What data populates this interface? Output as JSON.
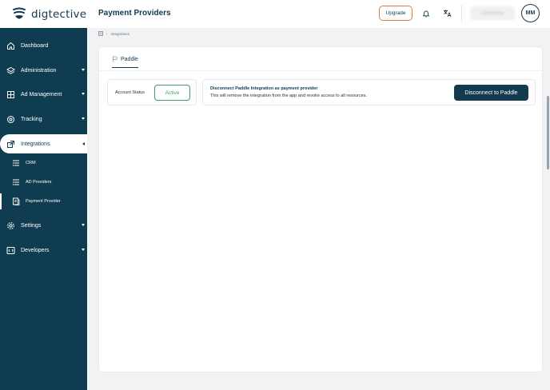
{
  "app": {
    "logo_text": "digtective",
    "logo_icon": "digtective-logo-icon"
  },
  "header": {
    "title": "Payment Providers",
    "upgrade_label": "Upgrade",
    "bell_icon": "bell-icon",
    "language_icon": "translate-icon",
    "user_name": "Username",
    "avatar_initials": "MM"
  },
  "sidebar": {
    "items": [
      {
        "label": "Dashboard",
        "icon": "home-icon"
      },
      {
        "label": "Administration",
        "icon": "layers-icon"
      },
      {
        "label": "Ad Management",
        "icon": "grid-icon"
      },
      {
        "label": "Tracking",
        "icon": "target-icon"
      },
      {
        "label": "Integrations",
        "icon": "integrations-icon"
      },
      {
        "label": "Settings",
        "icon": "gear-icon"
      },
      {
        "label": "Developers",
        "icon": "code-icon"
      }
    ],
    "sub_items": [
      {
        "label": "CRM",
        "icon": "list-icon"
      },
      {
        "label": "AD Providers",
        "icon": "list-icon"
      },
      {
        "label": "Payment Provider",
        "icon": "document-icon"
      }
    ]
  },
  "breadcrumb": {
    "home_icon": "home-icon",
    "current": "Integrations"
  },
  "tabs": [
    {
      "label": "Paddle",
      "icon": "paddle-icon"
    }
  ],
  "account_status": {
    "label": "Account Status",
    "value": "Active"
  },
  "disconnect": {
    "title": "Disconnect Paddle Integration as payment provider",
    "description": "This will remove the integration from the app and revoke access to all resources.",
    "button_label": "Disconnect to Paddle"
  },
  "colors": {
    "sidebar": "#0f3c51",
    "primary": "#143a4f",
    "accent_orange": "#e07a3e",
    "status_green": "#3f9a6b"
  }
}
